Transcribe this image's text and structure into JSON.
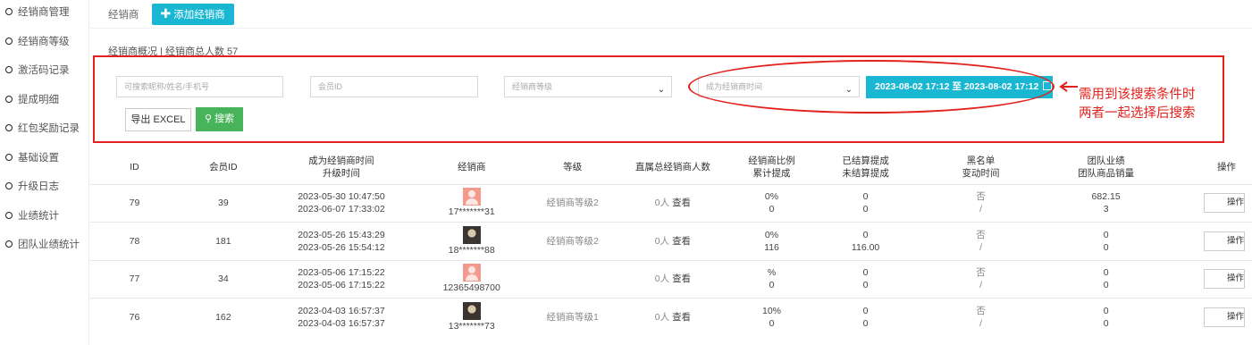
{
  "sidebar": {
    "items": [
      {
        "label": "经销商管理"
      },
      {
        "label": "经销商等级"
      },
      {
        "label": "激活码记录"
      },
      {
        "label": "提成明细"
      },
      {
        "label": "红包奖励记录"
      },
      {
        "label": "基础设置"
      },
      {
        "label": "升级日志"
      },
      {
        "label": "业绩统计"
      },
      {
        "label": "团队业绩统计"
      }
    ]
  },
  "topbar": {
    "tab_label": "经销商",
    "add_button": "添加经销商"
  },
  "summary": "经销商概况 | 经销商总人数 57",
  "filters": {
    "search_placeholder": "可搜索昵称/姓名/手机号",
    "member_id_placeholder": "会员ID",
    "level_select": "经销商等级",
    "time_select": "成为经销商时间",
    "date_range": "2023-08-02 17:12 至 2023-08-02 17:12",
    "export_button": "导出 EXCEL",
    "search_button": "搜索"
  },
  "annotation": {
    "line1": "需用到该搜索条件时",
    "line2": "两者一起选择后搜索",
    "color": "#e2211c"
  },
  "table": {
    "headers": [
      {
        "l1": "ID",
        "l2": ""
      },
      {
        "l1": "会员ID",
        "l2": ""
      },
      {
        "l1": "成为经销商时间",
        "l2": "升级时间"
      },
      {
        "l1": "经销商",
        "l2": ""
      },
      {
        "l1": "等级",
        "l2": ""
      },
      {
        "l1": "直属总经销商人数",
        "l2": ""
      },
      {
        "l1": "经销商比例",
        "l2": "累计提成"
      },
      {
        "l1": "已结算提成",
        "l2": "未结算提成"
      },
      {
        "l1": "黑名单",
        "l2": "变动时间"
      },
      {
        "l1": "团队业绩",
        "l2": "团队商品销量"
      },
      {
        "l1": "操作",
        "l2": ""
      }
    ],
    "rows": [
      {
        "id": "79",
        "member_id": "39",
        "join_time": "2023-05-30 10:47:50",
        "upgrade_time": "2023-06-07 17:33:02",
        "avatar": "pink",
        "dealer": "17*******31",
        "level": "经销商等级2",
        "direct_count": "0人",
        "view": "查看",
        "ratio": "0%",
        "total_commission": "0",
        "settled": "0",
        "unsettled": "0",
        "blacklist": "否",
        "change_time": "/",
        "team_perf": "682.15",
        "team_sales": "3",
        "op": "操作"
      },
      {
        "id": "78",
        "member_id": "181",
        "join_time": "2023-05-26 15:43:29",
        "upgrade_time": "2023-05-26 15:54:12",
        "avatar": "photo",
        "dealer": "18*******88",
        "level": "经销商等级2",
        "direct_count": "0人",
        "view": "查看",
        "ratio": "0%",
        "total_commission": "116",
        "settled": "0",
        "unsettled": "116.00",
        "blacklist": "否",
        "change_time": "/",
        "team_perf": "0",
        "team_sales": "0",
        "op": "操作"
      },
      {
        "id": "77",
        "member_id": "34",
        "join_time": "2023-05-06 17:15:22",
        "upgrade_time": "2023-05-06 17:15:22",
        "avatar": "pink",
        "dealer": "12365498700",
        "level": "",
        "direct_count": "0人",
        "view": "查看",
        "ratio": "%",
        "total_commission": "0",
        "settled": "0",
        "unsettled": "0",
        "blacklist": "否",
        "change_time": "/",
        "team_perf": "0",
        "team_sales": "0",
        "op": "操作"
      },
      {
        "id": "76",
        "member_id": "162",
        "join_time": "2023-04-03 16:57:37",
        "upgrade_time": "2023-04-03 16:57:37",
        "avatar": "photo",
        "dealer": "13*******73",
        "level": "经销商等级1",
        "direct_count": "0人",
        "view": "查看",
        "ratio": "10%",
        "total_commission": "0",
        "settled": "0",
        "unsettled": "0",
        "blacklist": "否",
        "change_time": "/",
        "team_perf": "0",
        "team_sales": "0",
        "op": "操作"
      }
    ]
  }
}
